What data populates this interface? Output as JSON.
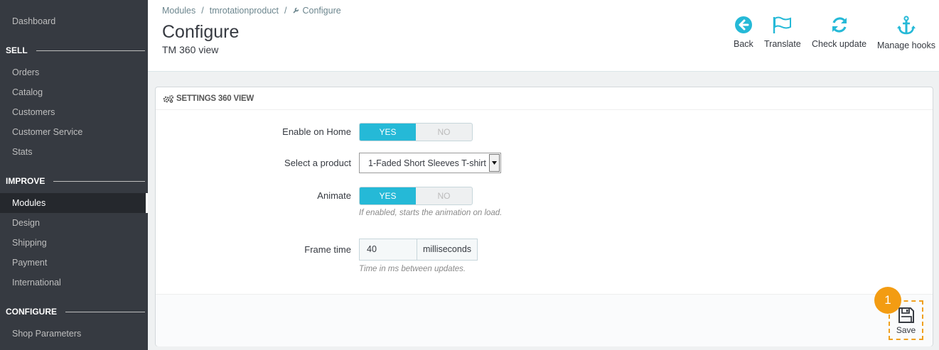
{
  "sidebar": {
    "dashboard": "Dashboard",
    "sections": [
      "SELL",
      "IMPROVE",
      "CONFIGURE"
    ],
    "sell": [
      "Orders",
      "Catalog",
      "Customers",
      "Customer Service",
      "Stats"
    ],
    "improve": [
      "Modules",
      "Design",
      "Shipping",
      "Payment",
      "International"
    ],
    "configure": [
      "Shop Parameters"
    ],
    "active_item": "Modules"
  },
  "header": {
    "breadcrumb": [
      "Modules",
      "tmrotationproduct",
      "Configure"
    ],
    "title": "Configure",
    "subtitle": "TM 360 view",
    "toolbar": [
      {
        "label": "Back",
        "icon": "back-circle-icon"
      },
      {
        "label": "Translate",
        "icon": "flag-icon"
      },
      {
        "label": "Check update",
        "icon": "refresh-icon"
      },
      {
        "label": "Manage hooks",
        "icon": "anchor-icon"
      }
    ]
  },
  "panel": {
    "title": "SETTINGS 360 VIEW",
    "fields": {
      "enable_home": {
        "label": "Enable on Home",
        "yes": "YES",
        "no": "NO",
        "value": "YES"
      },
      "product": {
        "label": "Select a product",
        "value": "1-Faded Short Sleeves T-shirt"
      },
      "animate": {
        "label": "Animate",
        "yes": "YES",
        "no": "NO",
        "value": "YES",
        "help": "If enabled, starts the animation on load."
      },
      "frame_time": {
        "label": "Frame time",
        "value": "40",
        "suffix": "milliseconds",
        "help": "Time in ms between updates."
      }
    },
    "save_label": "Save"
  },
  "annotation": {
    "step": "1"
  },
  "colors": {
    "accent": "#25b9d7",
    "sidebar": "#363a41",
    "annotation": "#f39c12"
  }
}
